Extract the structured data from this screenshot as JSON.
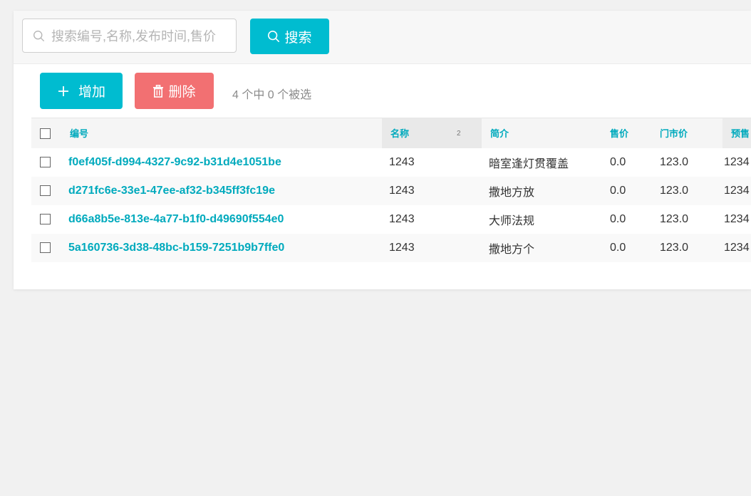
{
  "search": {
    "placeholder": "搜索编号,名称,发布时间,售价",
    "button_label": "搜索"
  },
  "toolbar": {
    "add_label": "增加",
    "delete_label": "删除",
    "selection_info": "4 个中 0 个被选"
  },
  "table": {
    "columns": {
      "id": "编号",
      "name": "名称",
      "name_sort_order": "2",
      "intro": "简介",
      "price": "售价",
      "market_price": "门市价",
      "presale": "预售"
    },
    "rows": [
      {
        "id": "f0ef405f-d994-4327-9c92-b31d4e1051be",
        "name": "1243",
        "intro": "暗室逢灯贯覆盖",
        "price": "0.0",
        "market_price": "123.0",
        "presale": "1234"
      },
      {
        "id": "d271fc6e-33e1-47ee-af32-b345ff3fc19e",
        "name": "1243",
        "intro": "撒地方放",
        "price": "0.0",
        "market_price": "123.0",
        "presale": "1234"
      },
      {
        "id": "d66a8b5e-813e-4a77-b1f0-d49690f554e0",
        "name": "1243",
        "intro": "大师法规",
        "price": "0.0",
        "market_price": "123.0",
        "presale": "1234"
      },
      {
        "id": "5a160736-3d38-48bc-b159-7251b9b7ffe0",
        "name": "1243",
        "intro": "撒地方个",
        "price": "0.0",
        "market_price": "123.0",
        "presale": "1234"
      }
    ]
  },
  "colors": {
    "accent": "#00bcd0",
    "danger": "#f27072",
    "link": "#00aabd"
  }
}
